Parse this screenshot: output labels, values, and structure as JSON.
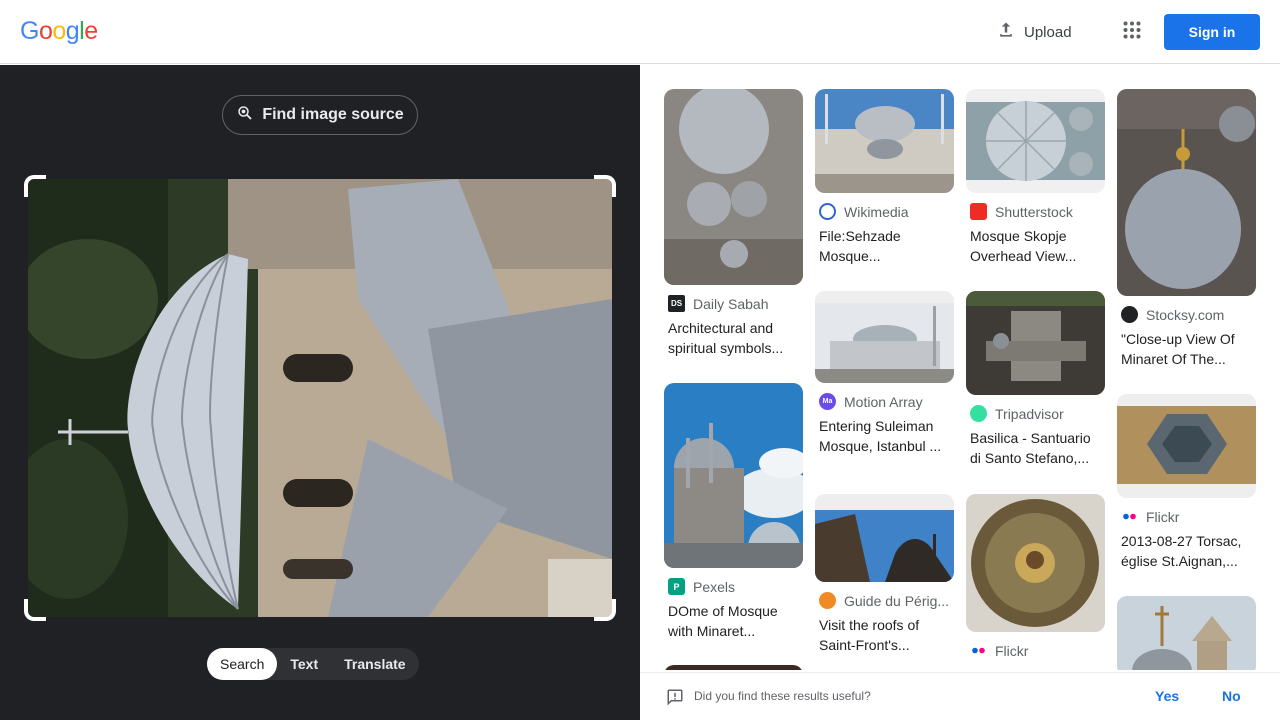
{
  "header": {
    "logo_letters": [
      "G",
      "o",
      "o",
      "g",
      "l",
      "e"
    ],
    "logo_colors": [
      "#4285f4",
      "#ea4335",
      "#fbbc05",
      "#4285f4",
      "#34a853",
      "#ea4335"
    ],
    "upload_label": "Upload",
    "signin_label": "Sign in",
    "accent": "#1a73e8"
  },
  "lens": {
    "find_source_label": "Find image source",
    "modes": [
      "Search",
      "Text",
      "Translate"
    ],
    "active_mode": "Search"
  },
  "results": [
    {
      "source": "Daily Sabah",
      "icon": "DS",
      "icon_color": "#202124",
      "title": "Architectural and spiritual symbols..."
    },
    {
      "source": "Pexels",
      "icon": "P",
      "icon_color": "#05a081",
      "title": "DOme of Mosque with Minaret..."
    },
    {
      "source": "Wikimedia",
      "icon": "W",
      "icon_color": "#3366cc",
      "title": "File:Sehzade Mosque..."
    },
    {
      "source": "Motion Array",
      "icon": "Ma",
      "icon_color": "#6b4ce6",
      "title": "Entering Suleiman Mosque, Istanbul ..."
    },
    {
      "source": "Guide du Périg...",
      "icon": "G",
      "icon_color": "#f08a24",
      "title": "Visit the roofs of Saint-Front's..."
    },
    {
      "source": "Shutterstock",
      "icon": "S",
      "icon_color": "#ee2b24",
      "title": "Mosque Skopje Overhead View..."
    },
    {
      "source": "Tripadvisor",
      "icon": "T",
      "icon_color": "#34e0a1",
      "title": "Basilica - Santuario di Santo Stefano,..."
    },
    {
      "source": "Flickr",
      "icon": "••",
      "icon_color": "#ffffff",
      "title": ""
    },
    {
      "source": "Stocksy.com",
      "icon": "S",
      "icon_color": "#202124",
      "title": "\"Close-up View Of Minaret Of The..."
    },
    {
      "source": "Flickr",
      "icon": "••",
      "icon_color": "#ffffff",
      "title": "2013-08-27 Torsac, église St.Aignan,..."
    }
  ],
  "feedback": {
    "question": "Did you find these results useful?",
    "yes_label": "Yes",
    "no_label": "No"
  }
}
